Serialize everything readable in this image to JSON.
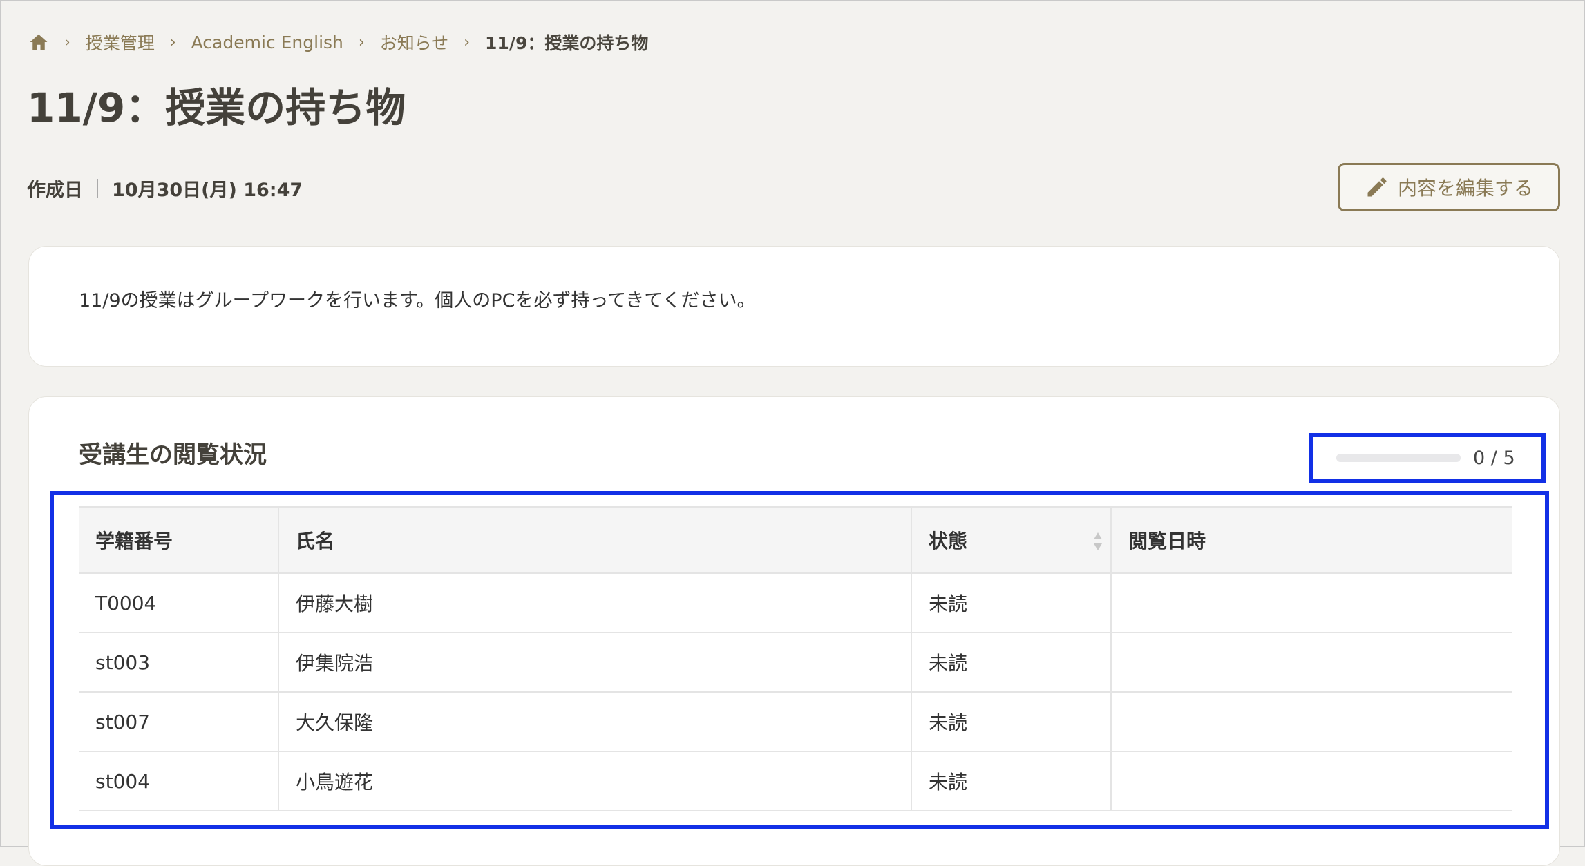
{
  "breadcrumb": {
    "items": [
      "授業管理",
      "Academic English",
      "お知らせ"
    ],
    "current": "11/9：授業の持ち物"
  },
  "page": {
    "title": "11/9：授業の持ち物"
  },
  "meta": {
    "label": "作成日",
    "value": "10月30日(月) 16:47"
  },
  "edit_button": {
    "label": "内容を編集する"
  },
  "message": {
    "body": "11/9の授業はグループワークを行います。個人のPCを必ず持ってきてください。"
  },
  "status_section": {
    "title": "受講生の閲覧状況",
    "progress": {
      "text": "0 / 5",
      "read": 0,
      "total": 5
    }
  },
  "table": {
    "headers": [
      "学籍番号",
      "氏名",
      "状態",
      "閲覧日時"
    ],
    "rows": [
      {
        "id": "T0004",
        "name": "伊藤大樹",
        "status": "未読",
        "viewed_at": ""
      },
      {
        "id": "st003",
        "name": "伊集院浩",
        "status": "未読",
        "viewed_at": ""
      },
      {
        "id": "st007",
        "name": "大久保隆",
        "status": "未読",
        "viewed_at": ""
      },
      {
        "id": "st004",
        "name": "小鳥遊花",
        "status": "未読",
        "viewed_at": ""
      }
    ]
  },
  "icons": {
    "home": "home-icon",
    "chevron": "chevron-right-icon",
    "edit": "pencil-icon",
    "sort": "sort-icon"
  },
  "colors": {
    "accent": "#8a7a55",
    "unread": "#d9534f",
    "highlight": "#1230e6"
  }
}
